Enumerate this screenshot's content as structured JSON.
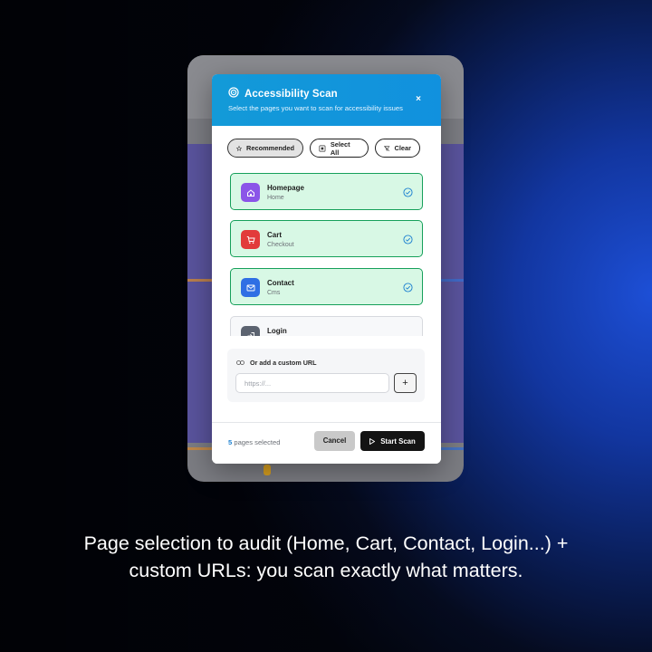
{
  "modal": {
    "title": "Accessibility Scan",
    "subtitle": "Select the pages you want to scan for accessibility issues",
    "close_icon": "close-icon"
  },
  "filters": {
    "recommended": "Recommended",
    "select_all": "Select All",
    "clear": "Clear"
  },
  "pages": [
    {
      "name": "Homepage",
      "type": "Home",
      "icon": "home-icon",
      "color": "#8b55e8",
      "selected": true
    },
    {
      "name": "Cart",
      "type": "Checkout",
      "icon": "cart-icon",
      "color": "#e23b3b",
      "selected": true
    },
    {
      "name": "Contact",
      "type": "Cms",
      "icon": "mail-icon",
      "color": "#2f6fe4",
      "selected": true
    },
    {
      "name": "Login",
      "type": "",
      "icon": "login-icon",
      "color": "#5c6370",
      "selected": false
    }
  ],
  "custom_url": {
    "label": "Or add a custom URL",
    "placeholder": "https://...",
    "add_label": "+"
  },
  "footer": {
    "count": "5",
    "count_suffix": " pages selected",
    "cancel": "Cancel",
    "start": "Start Scan"
  },
  "caption": "Page selection to audit (Home, Cart, Contact, Login...) + custom URLs: you scan exactly what matters.",
  "colors": {
    "header": "#139ad8",
    "selected_bg": "#d8f8e5",
    "selected_border": "#16a05a",
    "accent": "#1a7fd0"
  }
}
